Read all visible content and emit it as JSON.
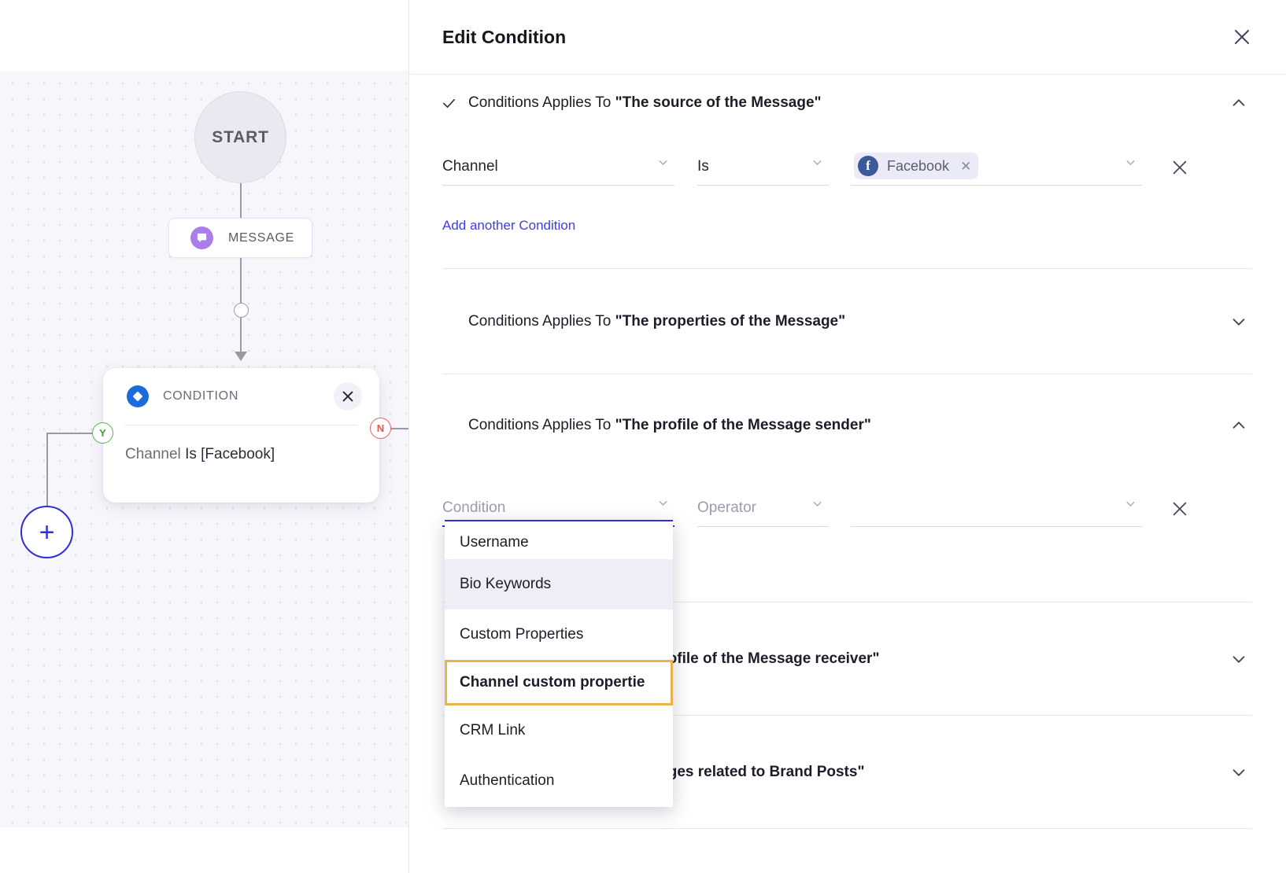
{
  "flow": {
    "start_label": "START",
    "message_label": "MESSAGE",
    "message_icon": "chat-bubble-icon",
    "condition_card": {
      "title": "CONDITION",
      "icon": "diamond-icon",
      "close_icon": "close-icon",
      "summary_prefix": "Channel ",
      "summary_rest": "Is [Facebook]"
    },
    "port_yes": "Y",
    "port_no": "N",
    "add_button": "+"
  },
  "panel": {
    "title": "Edit Condition",
    "close_icon": "close-icon"
  },
  "sections": [
    {
      "check": "✓",
      "prefix": "Conditions Applies To ",
      "target": "\"The source of the Message\"",
      "chevron": "chevron-up-icon"
    },
    {
      "check": "",
      "prefix": "Conditions Applies To ",
      "target": "\"The properties of the Message\"",
      "chevron": "chevron-down-icon"
    },
    {
      "check": "",
      "prefix": "Conditions Applies To ",
      "target": "\"The profile of the Message sender\"",
      "chevron": "chevron-up-icon"
    },
    {
      "check": "",
      "prefix": "Conditions Applies To ",
      "target": "\"The profile of the Message receiver\"",
      "chevron": "chevron-down-icon"
    },
    {
      "check": "",
      "prefix": "Conditions Applies To ",
      "target": "\"Messages related to Brand Posts\"",
      "chevron": "chevron-down-icon"
    }
  ],
  "source_row": {
    "field_value": "Channel",
    "operator_value": "Is",
    "chip_label": "Facebook",
    "chip_icon": "facebook-icon",
    "chip_remove_icon": "close-icon",
    "remove_row_icon": "close-icon",
    "chevron_icon": "chevron-down-icon"
  },
  "add_another": "Add another Condition",
  "sender_row": {
    "field_placeholder": "Condition",
    "operator_placeholder": "Operator",
    "value_placeholder": "",
    "remove_row_icon": "close-icon",
    "chevron_icon": "chevron-down-icon"
  },
  "dropdown": {
    "options": [
      "Username",
      "Bio Keywords",
      "Custom Properties",
      "Channel custom propertie",
      "CRM Link",
      "Authentication"
    ],
    "hovered_index": 1,
    "selected_index": 3
  },
  "colors": {
    "accent_blue": "#2f2fd6",
    "highlight_orange": "#eab44a",
    "facebook_blue": "#3d5a98",
    "message_purple": "#a97ee8",
    "condition_blue": "#1b6bdc",
    "yes_green": "#53b84e",
    "no_red": "#e8625b"
  }
}
